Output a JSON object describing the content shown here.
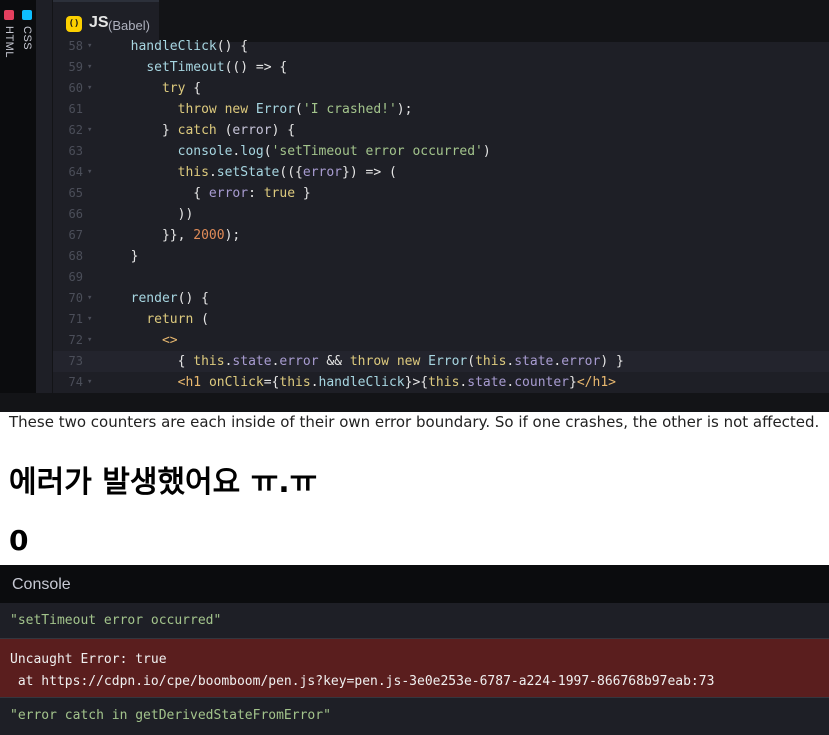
{
  "sidebar": {
    "tabs": [
      {
        "label": "HTML",
        "color": "#e4405f"
      },
      {
        "label": "CSS",
        "color": "#0ebeff"
      }
    ]
  },
  "editor": {
    "tab_label": "JS",
    "preprocessor": "(Babel)",
    "badge_glyph": "()",
    "lines": [
      {
        "n": "58",
        "fold": "▾",
        "tokens": [
          [
            "p",
            "  "
          ],
          [
            "f",
            "handleClick"
          ],
          [
            "p",
            "() {"
          ]
        ]
      },
      {
        "n": "59",
        "fold": "▾",
        "tokens": [
          [
            "p",
            "    "
          ],
          [
            "f",
            "setTimeout"
          ],
          [
            "p",
            "(() => {"
          ]
        ]
      },
      {
        "n": "60",
        "fold": "▾",
        "tokens": [
          [
            "p",
            "      "
          ],
          [
            "k",
            "try"
          ],
          [
            "p",
            " {"
          ]
        ]
      },
      {
        "n": "61",
        "fold": "",
        "tokens": [
          [
            "p",
            "        "
          ],
          [
            "k",
            "throw"
          ],
          [
            "p",
            " "
          ],
          [
            "k",
            "new"
          ],
          [
            "p",
            " "
          ],
          [
            "f",
            "Error"
          ],
          [
            "p",
            "("
          ],
          [
            "s",
            "'I crashed!'"
          ],
          [
            "p",
            ");"
          ]
        ]
      },
      {
        "n": "62",
        "fold": "▾",
        "tokens": [
          [
            "p",
            "      } "
          ],
          [
            "k",
            "catch"
          ],
          [
            "p",
            " ("
          ],
          [
            "v",
            "error"
          ],
          [
            "p",
            ") {"
          ]
        ]
      },
      {
        "n": "63",
        "fold": "",
        "tokens": [
          [
            "p",
            "        "
          ],
          [
            "f",
            "console"
          ],
          [
            "p",
            "."
          ],
          [
            "f",
            "log"
          ],
          [
            "p",
            "("
          ],
          [
            "s",
            "'setTimeout error occurred'"
          ],
          [
            "p",
            ")"
          ]
        ]
      },
      {
        "n": "64",
        "fold": "▾",
        "tokens": [
          [
            "p",
            "        "
          ],
          [
            "k",
            "this"
          ],
          [
            "p",
            "."
          ],
          [
            "f",
            "setState"
          ],
          [
            "p",
            "(({"
          ],
          [
            "pr",
            "error"
          ],
          [
            "p",
            "}) => ("
          ]
        ]
      },
      {
        "n": "65",
        "fold": "",
        "tokens": [
          [
            "p",
            "          { "
          ],
          [
            "pr",
            "error"
          ],
          [
            "p",
            ": "
          ],
          [
            "k",
            "true"
          ],
          [
            "p",
            " }"
          ]
        ]
      },
      {
        "n": "66",
        "fold": "",
        "tokens": [
          [
            "p",
            "        ))"
          ]
        ]
      },
      {
        "n": "67",
        "fold": "",
        "tokens": [
          [
            "p",
            "      }}, "
          ],
          [
            "n",
            "2000"
          ],
          [
            "p",
            ");"
          ]
        ]
      },
      {
        "n": "68",
        "fold": "",
        "tokens": [
          [
            "p",
            "  }"
          ]
        ]
      },
      {
        "n": "69",
        "fold": "",
        "tokens": [
          [
            "p",
            ""
          ]
        ]
      },
      {
        "n": "70",
        "fold": "▾",
        "tokens": [
          [
            "p",
            "  "
          ],
          [
            "f",
            "render"
          ],
          [
            "p",
            "() {"
          ]
        ]
      },
      {
        "n": "71",
        "fold": "▾",
        "tokens": [
          [
            "p",
            "    "
          ],
          [
            "k",
            "return"
          ],
          [
            "p",
            " ("
          ]
        ]
      },
      {
        "n": "72",
        "fold": "▾",
        "tokens": [
          [
            "p",
            "      "
          ],
          [
            "t",
            "<>"
          ]
        ]
      },
      {
        "n": "73",
        "fold": "",
        "active": true,
        "tokens": [
          [
            "p",
            "        { "
          ],
          [
            "k",
            "this"
          ],
          [
            "p",
            "."
          ],
          [
            "pr",
            "state"
          ],
          [
            "p",
            "."
          ],
          [
            "pr",
            "error"
          ],
          [
            "p",
            " && "
          ],
          [
            "k",
            "throw"
          ],
          [
            "p",
            " "
          ],
          [
            "k",
            "new"
          ],
          [
            "p",
            " "
          ],
          [
            "f",
            "Error"
          ],
          [
            "p",
            "("
          ],
          [
            "k",
            "this"
          ],
          [
            "p",
            "."
          ],
          [
            "pr",
            "state"
          ],
          [
            "p",
            "."
          ],
          [
            "pr",
            "error"
          ],
          [
            "p",
            ") }"
          ]
        ]
      },
      {
        "n": "74",
        "fold": "▾",
        "tokens": [
          [
            "p",
            "        "
          ],
          [
            "t",
            "<h1"
          ],
          [
            "p",
            " "
          ],
          [
            "a",
            "onClick"
          ],
          [
            "p",
            "={"
          ],
          [
            "k",
            "this"
          ],
          [
            "p",
            "."
          ],
          [
            "f",
            "handleClick"
          ],
          [
            "p",
            "}>{"
          ],
          [
            "k",
            "this"
          ],
          [
            "p",
            "."
          ],
          [
            "pr",
            "state"
          ],
          [
            "p",
            "."
          ],
          [
            "pr",
            "counter"
          ],
          [
            "p",
            "}"
          ],
          [
            "t",
            "</h1>"
          ]
        ]
      }
    ]
  },
  "preview": {
    "description": "These two counters are each inside of their own error boundary. So if one crashes, the other is not affected.",
    "heading": "에러가 발생했어요 ㅠ.ㅠ",
    "counter": "0"
  },
  "console": {
    "title": "Console",
    "entries": [
      {
        "type": "log",
        "text": "\"setTimeout error occurred\""
      },
      {
        "type": "error",
        "line1": "Uncaught Error: true",
        "line2": " at https://cdpn.io/cpe/boomboom/pen.js?key=pen.js-3e0e253e-6787-a224-1997-866768b97eab:73"
      },
      {
        "type": "log",
        "text": "\"error catch in getDerivedStateFromError\""
      }
    ]
  }
}
